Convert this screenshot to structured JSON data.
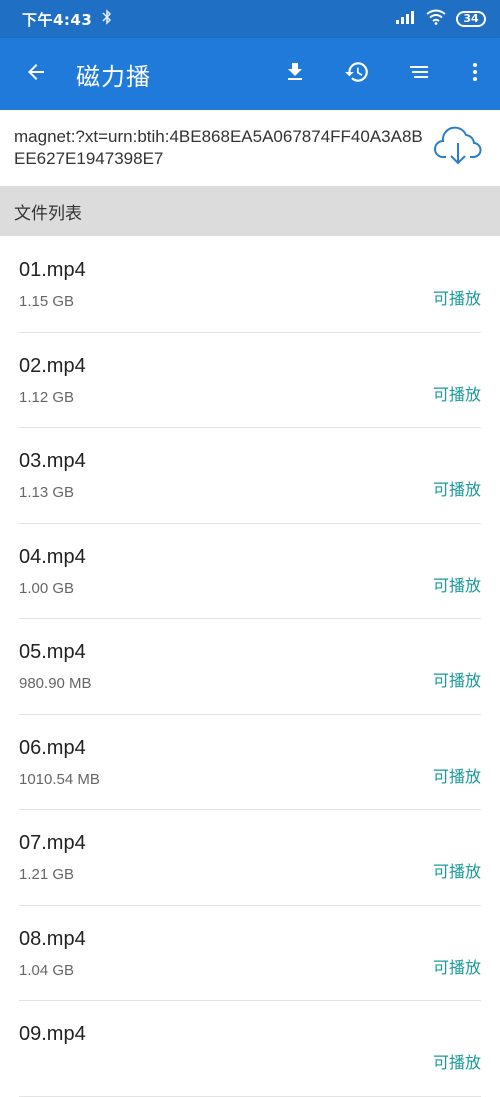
{
  "status_bar": {
    "time": "下午4:43",
    "battery": "34"
  },
  "app_bar": {
    "title": "磁力播",
    "icons": [
      "back-arrow-icon",
      "download-icon",
      "history-icon",
      "sort-icon",
      "more-vert-icon"
    ]
  },
  "magnet": {
    "link": "magnet:?xt=urn:btih:4BE868EA5A067874FF40A3A8BEE627E1947398E7"
  },
  "section": {
    "title": "文件列表"
  },
  "files": [
    {
      "name": "01.mp4",
      "size": "1.15 GB",
      "status": "可播放"
    },
    {
      "name": "02.mp4",
      "size": "1.12 GB",
      "status": "可播放"
    },
    {
      "name": "03.mp4",
      "size": "1.13 GB",
      "status": "可播放"
    },
    {
      "name": "04.mp4",
      "size": "1.00 GB",
      "status": "可播放"
    },
    {
      "name": "05.mp4",
      "size": "980.90 MB",
      "status": "可播放"
    },
    {
      "name": "06.mp4",
      "size": "1010.54 MB",
      "status": "可播放"
    },
    {
      "name": "07.mp4",
      "size": "1.21 GB",
      "status": "可播放"
    },
    {
      "name": "08.mp4",
      "size": "1.04 GB",
      "status": "可播放"
    },
    {
      "name": "09.mp4",
      "size": "",
      "status": "可播放"
    }
  ],
  "colors": {
    "status_bar": "#1f6fc4",
    "app_bar": "#1f7ad9",
    "section_bg": "#dcdcdc",
    "status_text": "#1a9a9a",
    "cloud_icon": "#2b7fc9"
  }
}
